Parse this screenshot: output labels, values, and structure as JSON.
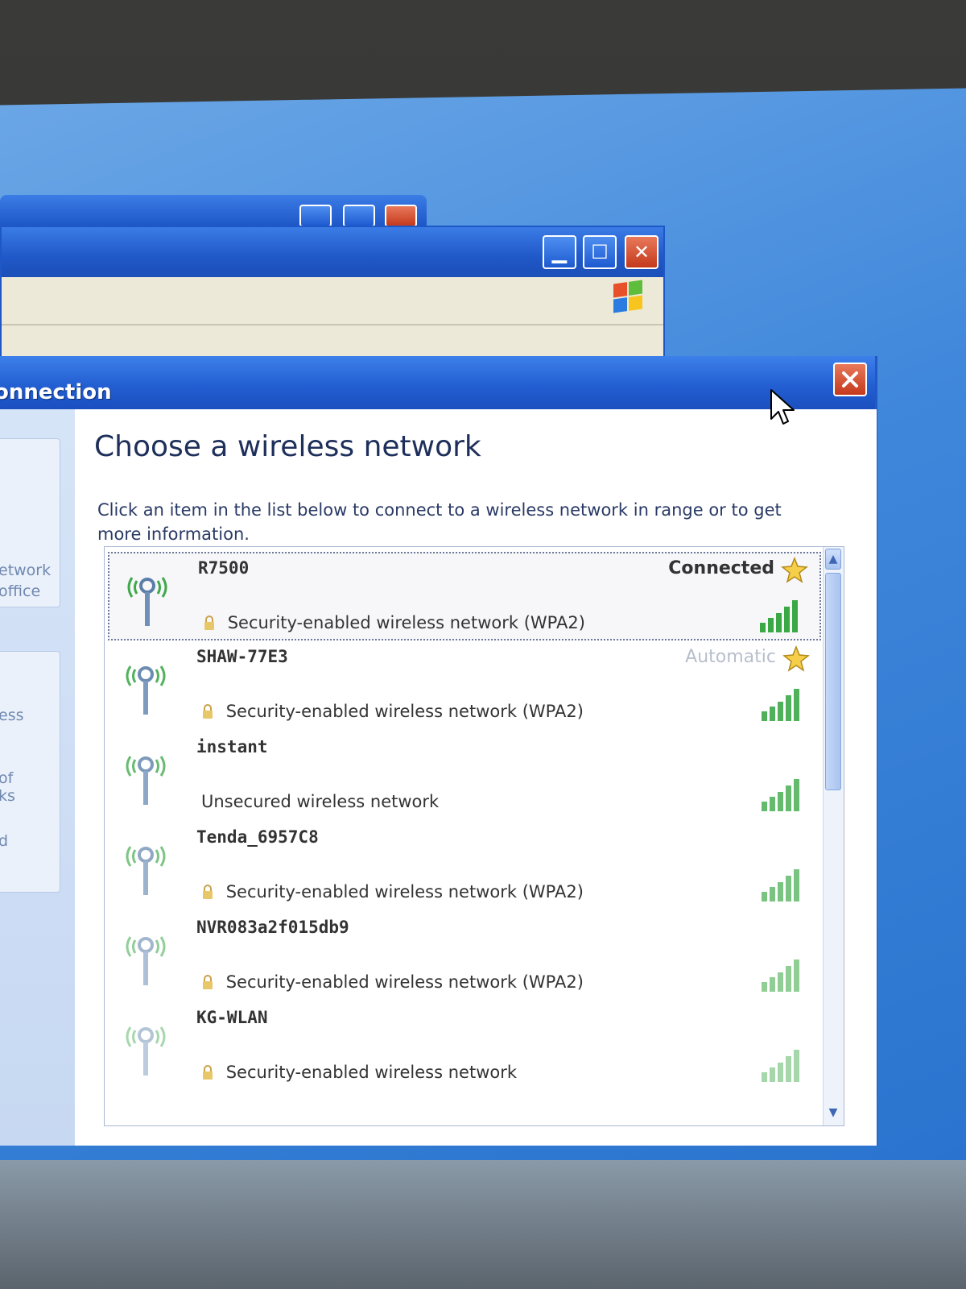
{
  "background_window": {
    "controls": [
      "minimize-icon",
      "maximize-icon",
      "close-icon"
    ]
  },
  "dialog": {
    "title_fragment": "onnection",
    "heading": "Choose a wireless network",
    "description": "Click an item in the list below to connect to a wireless network in range or to get more information.",
    "left_pane": {
      "box1_lines": [
        "etwork",
        "office"
      ],
      "box2_lines": [
        "ess",
        "of",
        "ks",
        "d"
      ]
    }
  },
  "networks": [
    {
      "name": "R7500",
      "security": "Security-enabled wireless network (WPA2)",
      "status": "Connected",
      "status_style": "bold",
      "selected": true,
      "secured": true,
      "preferred": true
    },
    {
      "name": "SHAW-77E3",
      "security": "Security-enabled wireless network (WPA2)",
      "status": "Automatic",
      "status_style": "faded",
      "selected": false,
      "secured": true,
      "preferred": true
    },
    {
      "name": "instant",
      "security": "Unsecured wireless network",
      "status": "",
      "selected": false,
      "secured": false,
      "preferred": false
    },
    {
      "name": "Tenda_6957C8",
      "security": "Security-enabled wireless network (WPA2)",
      "status": "",
      "selected": false,
      "secured": true,
      "preferred": false
    },
    {
      "name": "NVR083a2f015db9",
      "security": "Security-enabled wireless network (WPA2)",
      "status": "",
      "selected": false,
      "secured": true,
      "preferred": false
    },
    {
      "name": "KG-WLAN",
      "security": "Security-enabled wireless network",
      "status": "",
      "selected": false,
      "secured": true,
      "preferred": false
    }
  ],
  "colors": {
    "titlebar": "#235fd2",
    "signal_bar": "#3aa845",
    "desktop": "#3f87db"
  }
}
